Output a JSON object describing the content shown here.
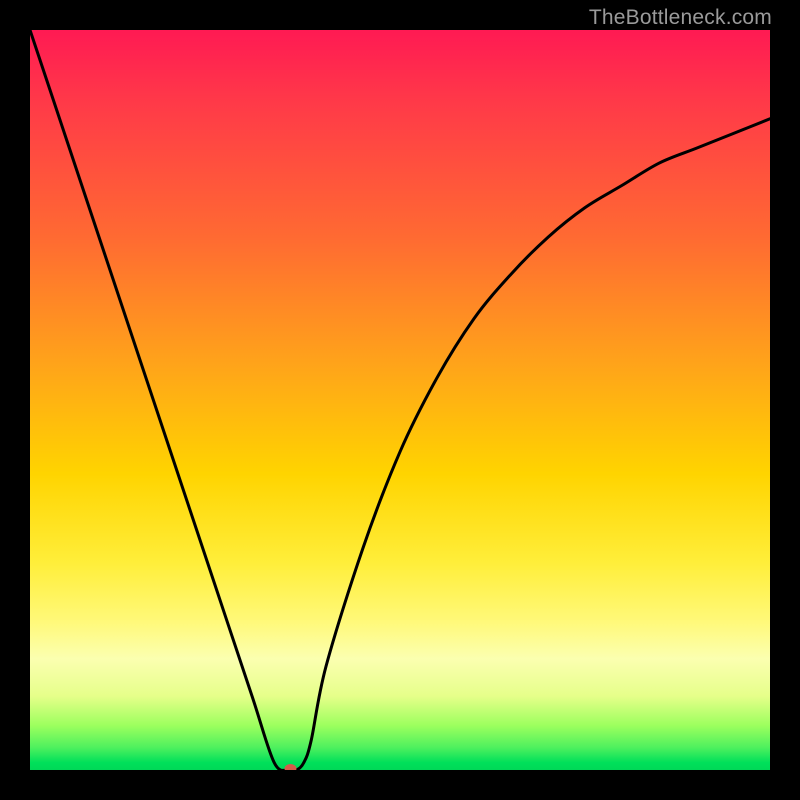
{
  "watermark": {
    "text": "TheBottleneck.com"
  },
  "chart_data": {
    "type": "line",
    "title": "",
    "xlabel": "",
    "ylabel": "",
    "xlim": [
      0,
      100
    ],
    "ylim": [
      0,
      100
    ],
    "grid": false,
    "legend": false,
    "background_gradient": {
      "direction": "vertical",
      "stops": [
        {
          "pos": 0.0,
          "color": "#ff1a53"
        },
        {
          "pos": 0.45,
          "color": "#ffa31a"
        },
        {
          "pos": 0.72,
          "color": "#ffee3a"
        },
        {
          "pos": 0.9,
          "color": "#e6ff8a"
        },
        {
          "pos": 1.0,
          "color": "#00d857"
        }
      ]
    },
    "series": [
      {
        "name": "bottleneck-curve",
        "color": "#000000",
        "x": [
          0,
          5,
          10,
          15,
          20,
          25,
          30,
          33,
          35,
          36,
          37,
          38,
          40,
          45,
          50,
          55,
          60,
          65,
          70,
          75,
          80,
          85,
          90,
          95,
          100
        ],
        "y": [
          100,
          85,
          70,
          55,
          40,
          25,
          10,
          1,
          0,
          0,
          1,
          4,
          14,
          30,
          43,
          53,
          61,
          67,
          72,
          76,
          79,
          82,
          84,
          86,
          88
        ]
      }
    ],
    "marker": {
      "name": "current-point",
      "x": 35.2,
      "y": 0.2,
      "color": "#d65a4a",
      "rx": 6,
      "ry": 4.5
    }
  }
}
